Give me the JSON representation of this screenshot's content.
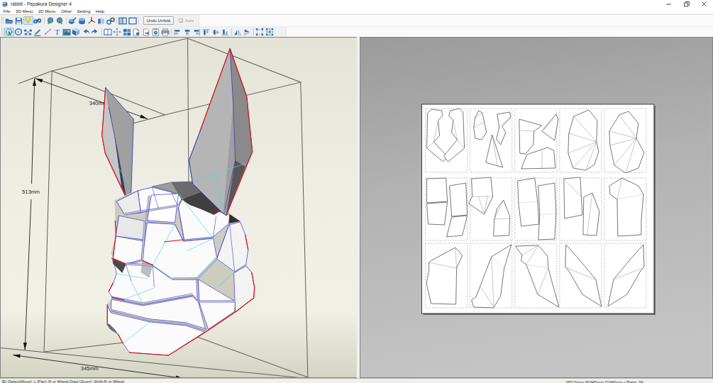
{
  "window": {
    "title": "rabbit - Pepakura Designer 4",
    "controls": [
      "minimize",
      "maximize",
      "close"
    ]
  },
  "menu": {
    "items": [
      "File",
      "3D Menu",
      "2D Menu",
      "Other",
      "Setting",
      "Help"
    ]
  },
  "toolbar": {
    "undo_unfold_label": "Undo Unfold",
    "auto_label": "Auto",
    "auto_checked": true,
    "row1_icons": [
      "open-folder",
      "save",
      "light",
      "view-find",
      "rotate-left",
      "rotate-right",
      "edit-solid",
      "solid",
      "axis",
      "flip-object",
      "joint-link",
      "two-pane-layout",
      "single-pane-layout"
    ],
    "row2_icons": [
      "select-move",
      "rotate-view",
      "select-parts",
      "edge-color-pen",
      "eraser-knife",
      "insert-text",
      "insert-image",
      "box-3d",
      "undo",
      "redo",
      "open-book",
      "move-part",
      "arrange-layout",
      "new-page",
      "page-arrow",
      "capture",
      "print",
      "align-left",
      "align-center-h",
      "align-right",
      "align-top",
      "align-center-v",
      "align-bottom",
      "mirror-horizontal",
      "mirror-vertical",
      "pattern-select",
      "pattern-all"
    ]
  },
  "viewport3d": {
    "dim_height_label": "513mm",
    "dim_depth_label": "340mm",
    "dim_width_label": "345mm",
    "model": "low-poly rabbit mask"
  },
  "viewport2d": {
    "page_cells": 15,
    "grid": "5x3"
  },
  "statusbar": {
    "left": "3D [Select/Move]: L  [Pan]: R or Wheel-Drag  [Zoom]: Shift+R or Wheel",
    "right": "H513mm W345mm D340mm / Parts 24"
  },
  "colors": {
    "accent_blue": "#2f6fb4",
    "highlight": "#cde6f7",
    "edge_red": "#dd1111",
    "edge_blue": "#3333cc",
    "fold_cyan": "#33dddd",
    "bg_3d_top": "#e4e4d8",
    "bg_3d_bottom": "#d5d6c5",
    "bg_2d": "#b4b4b4",
    "page_white": "#ffffff"
  }
}
